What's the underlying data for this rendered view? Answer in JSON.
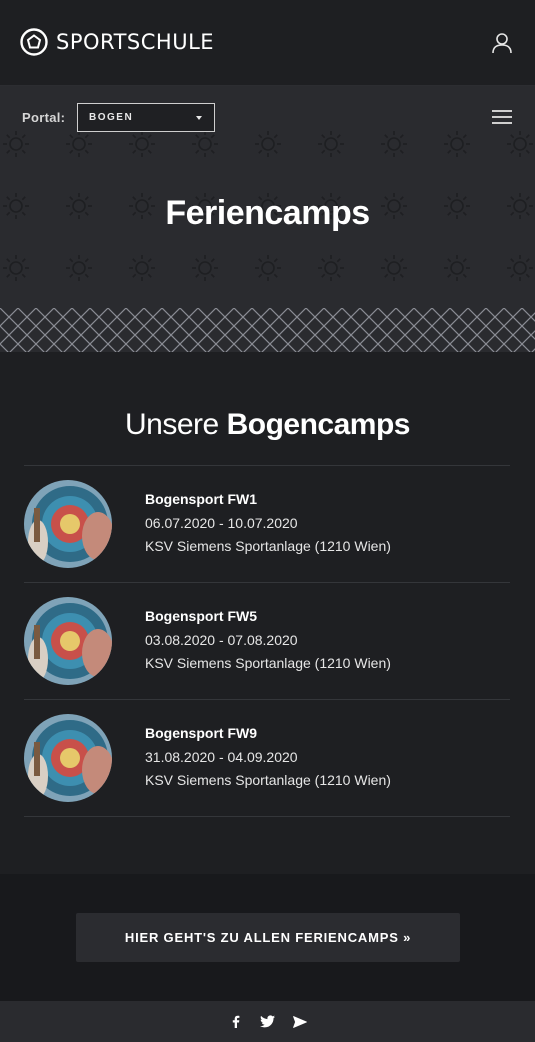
{
  "header": {
    "brand": "SPORTSCHULE",
    "icons": {
      "logo": "sportschule-logo-icon",
      "user": "user-icon"
    }
  },
  "hero": {
    "portal_label": "Portal:",
    "portal_value": "BOGEN",
    "title": "Feriencamps",
    "icons": {
      "menu": "hamburger-menu-icon",
      "caret": "caret-down-icon",
      "pattern": "sun-icon"
    }
  },
  "section": {
    "title_light": "Unsere",
    "title_bold": "Bogencamps"
  },
  "camps": [
    {
      "name": "Bogensport FW1",
      "dates": "06.07.2020 - 10.07.2020",
      "location": "KSV Siemens Sportanlage (1210 Wien)"
    },
    {
      "name": "Bogensport FW5",
      "dates": "03.08.2020 - 07.08.2020",
      "location": "KSV Siemens Sportanlage (1210 Wien)"
    },
    {
      "name": "Bogensport FW9",
      "dates": "31.08.2020 - 04.09.2020",
      "location": "KSV Siemens Sportanlage (1210 Wien)"
    }
  ],
  "cta": {
    "label": "HIER GEHT'S ZU ALLEN FERIENCAMPS »"
  },
  "footer": {
    "social": [
      "facebook-icon",
      "twitter-icon",
      "telegram-icon"
    ]
  },
  "colors": {
    "background": "#1e1f22",
    "hero": "#2a2b2f",
    "cta_band": "#18191c",
    "divider": "#34363a"
  }
}
